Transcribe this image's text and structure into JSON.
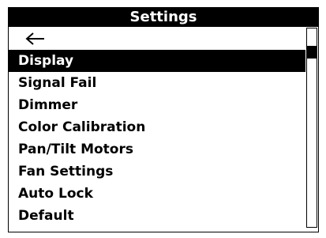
{
  "window": {
    "title": "Settings"
  },
  "menu": {
    "back_icon": "left-arrow-icon",
    "items": [
      {
        "label": "Display",
        "selected": true
      },
      {
        "label": "Signal Fail",
        "selected": false
      },
      {
        "label": "Dimmer",
        "selected": false
      },
      {
        "label": "Color Calibration",
        "selected": false
      },
      {
        "label": "Pan/Tilt Motors",
        "selected": false
      },
      {
        "label": "Fan Settings",
        "selected": false
      },
      {
        "label": "Auto Lock",
        "selected": false
      },
      {
        "label": "Default",
        "selected": false
      }
    ]
  },
  "colors": {
    "background": "#ffffff",
    "foreground": "#000000",
    "highlight": "#000000",
    "highlight_text": "#ffffff"
  }
}
